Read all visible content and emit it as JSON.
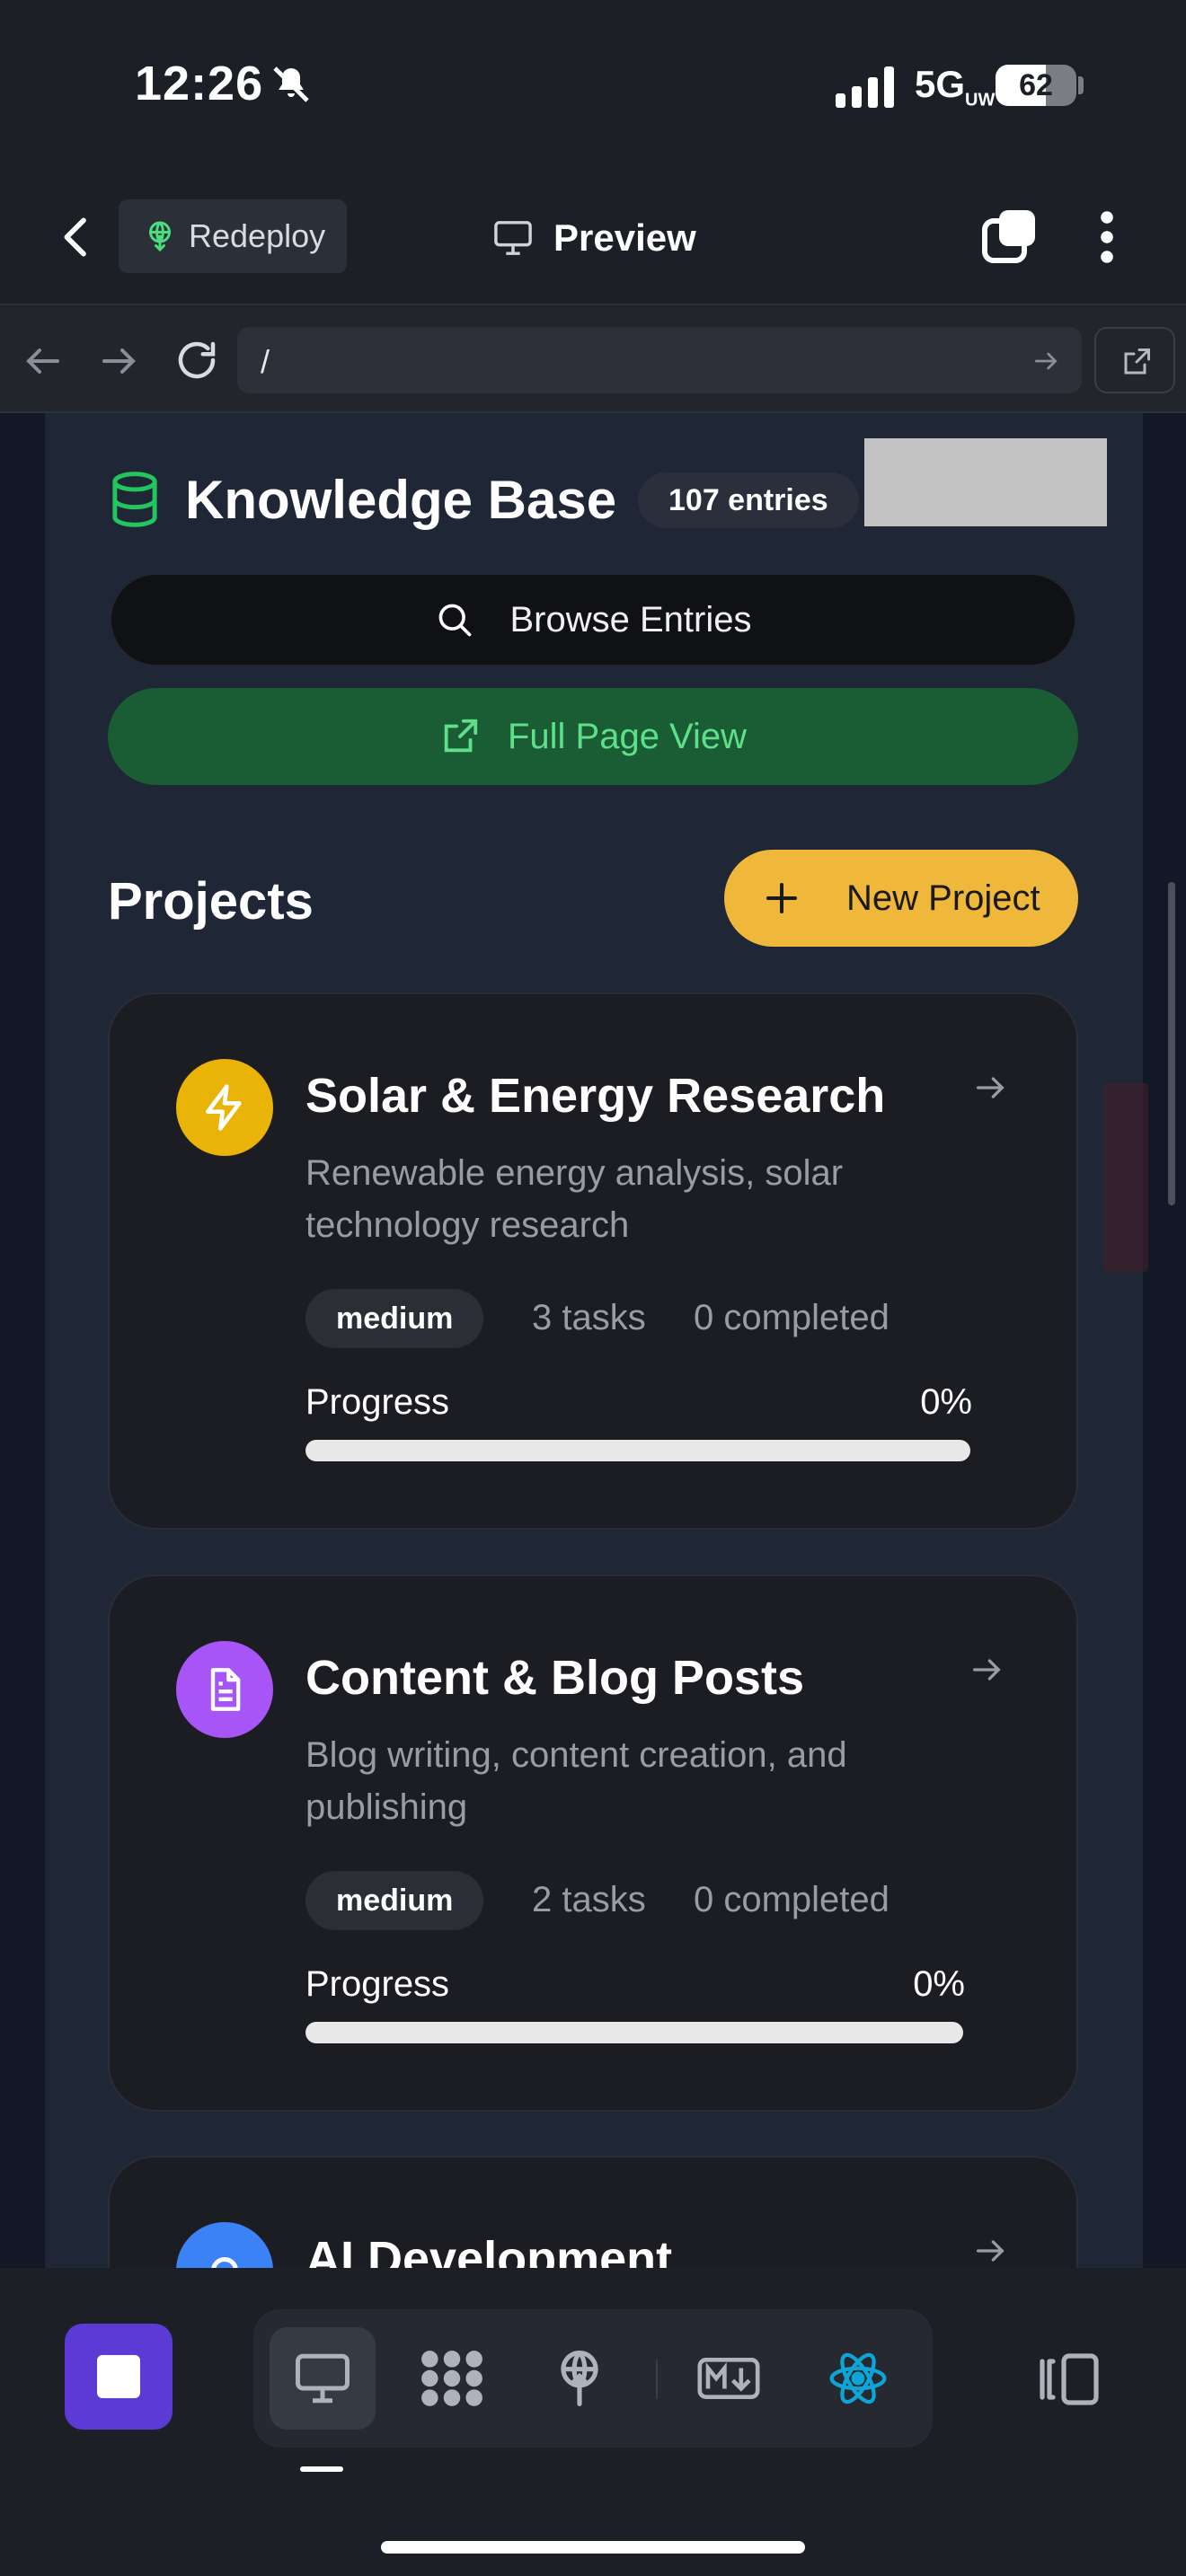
{
  "status_bar": {
    "time": "12:26",
    "network": "5G",
    "network_sub": "UW",
    "battery": "62"
  },
  "header": {
    "redeploy_label": "Redeploy",
    "title": "Preview"
  },
  "url_bar": {
    "url": "/"
  },
  "knowledge_base": {
    "title": "Knowledge Base",
    "count_badge": "107 entries",
    "browse_label": "Browse Entries",
    "full_page_label": "Full Page View"
  },
  "projects": {
    "title": "Projects",
    "new_label": "New Project",
    "items": [
      {
        "name": "Solar & Energy Research",
        "description": "Renewable energy analysis, solar technology research",
        "priority": "medium",
        "tasks": "3 tasks",
        "completed": "0 completed",
        "progress_label": "Progress",
        "progress_text": "0%",
        "progress": 0,
        "color": "#eab308",
        "icon": "lightning-icon"
      },
      {
        "name": "Content & Blog Posts",
        "description": "Blog writing, content creation, and publishing",
        "priority": "medium",
        "tasks": "2 tasks",
        "completed": "0 completed",
        "progress_label": "Progress",
        "progress_text": "0%",
        "progress": 0,
        "color": "#a855f7",
        "icon": "document-icon"
      },
      {
        "name": "AI Development",
        "color": "#3b82f6",
        "icon": "search-icon"
      }
    ]
  },
  "dock": {
    "icons": [
      "stop-icon",
      "desktop-icon",
      "cluster-icon",
      "deploy-icon",
      "markdown-icon",
      "react-icon",
      "layout-icon"
    ]
  },
  "colors": {
    "accent_green": "#5ee08a",
    "new_project_yellow": "#f0b83a",
    "stop_purple": "#5b3ad6"
  }
}
